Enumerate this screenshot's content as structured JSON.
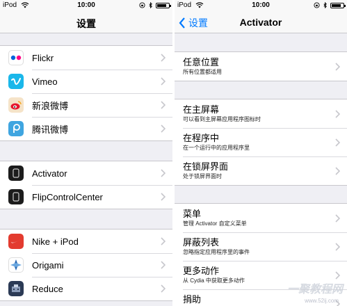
{
  "left": {
    "status": {
      "carrier": "iPod",
      "time": "10:00",
      "battery_level": 0.8
    },
    "nav": {
      "title": "设置"
    },
    "groups": [
      [
        {
          "label": "Flickr",
          "icon": "flickr-icon"
        },
        {
          "label": "Vimeo",
          "icon": "vimeo-icon"
        },
        {
          "label": "新浪微博",
          "icon": "sina-weibo-icon"
        },
        {
          "label": "腾讯微博",
          "icon": "tencent-weibo-icon"
        }
      ],
      [
        {
          "label": "Activator",
          "icon": "activator-icon"
        },
        {
          "label": "FlipControlCenter",
          "icon": "flipcontrolcenter-icon"
        }
      ],
      [
        {
          "label": "Nike + iPod",
          "icon": "nike-icon"
        },
        {
          "label": "Origami",
          "icon": "origami-icon"
        },
        {
          "label": "Reduce",
          "icon": "reduce-icon"
        }
      ]
    ]
  },
  "right": {
    "status": {
      "carrier": "iPod",
      "time": "10:00",
      "battery_level": 0.8
    },
    "nav": {
      "title": "Activator",
      "back_label": "设置"
    },
    "groups": [
      [
        {
          "title": "任意位置",
          "subtitle": "所有位置都适用"
        }
      ],
      [
        {
          "title": "在主屏幕",
          "subtitle": "可以看到主屏幕应用程序图标时"
        },
        {
          "title": "在程序中",
          "subtitle": "在一个运行中的应用程序里"
        },
        {
          "title": "在锁屏界面",
          "subtitle": "处于锁屏界面时"
        }
      ],
      [
        {
          "title": "菜单",
          "subtitle": "管理 Activator 自定义菜单"
        },
        {
          "title": "屏蔽列表",
          "subtitle": "忽略指定应用程序里的事件"
        },
        {
          "title": "更多动作",
          "subtitle": "从 Cydia 中获取更多动作"
        },
        {
          "title": "捐助",
          "subtitle": ""
        }
      ]
    ]
  },
  "watermark": {
    "text": "一聚教程网",
    "url": "www.52ij.com"
  },
  "colors": {
    "accent": "#007aff",
    "background": "#efeff4",
    "separator": "#c8c7cc"
  }
}
